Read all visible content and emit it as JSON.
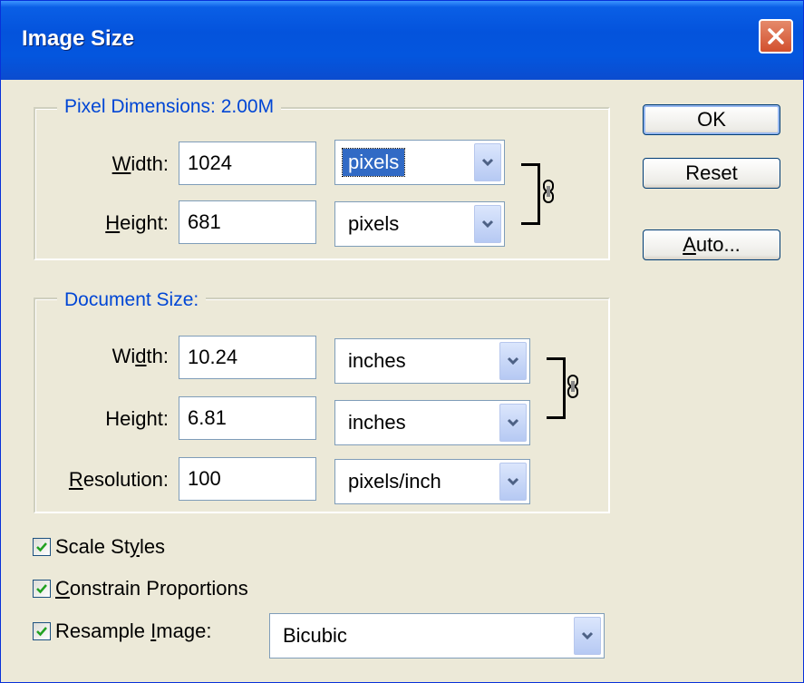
{
  "window": {
    "title": "Image Size",
    "close_icon": "close-icon"
  },
  "pixel_dimensions": {
    "legend": "Pixel Dimensions:  2.00M",
    "width": {
      "label_pre": "",
      "label_key": "W",
      "label_post": "idth:",
      "value": "1024",
      "unit": "pixels"
    },
    "height": {
      "label_pre": "",
      "label_key": "H",
      "label_post": "eight:",
      "value": "681",
      "unit": "pixels"
    }
  },
  "document_size": {
    "legend": "Document Size:",
    "width": {
      "label_pre": "Wi",
      "label_key": "d",
      "label_post": "th:",
      "value": "10.24",
      "unit": "inches"
    },
    "height": {
      "label_pre": "Hei",
      "label_key": "g",
      "label_post": "ht:",
      "value": "6.81",
      "unit": "inches"
    },
    "resolution": {
      "label_pre": "",
      "label_key": "R",
      "label_post": "esolution:",
      "value": "100",
      "unit": "pixels/inch"
    }
  },
  "buttons": {
    "ok": "OK",
    "reset": "Reset",
    "auto_key": "A",
    "auto_rest": "uto..."
  },
  "options": {
    "scale_styles": {
      "pre": "Scale St",
      "key": "y",
      "post": "les",
      "checked": true
    },
    "constrain": {
      "pre": "",
      "key": "C",
      "post": "onstrain Proportions",
      "checked": true
    },
    "resample": {
      "pre": "Resample ",
      "key": "I",
      "post": "mage:",
      "checked": true,
      "method": "Bicubic"
    }
  },
  "colors": {
    "title_bar": "#0453dc",
    "legend_text": "#0046d5",
    "dialog_bg": "#ece9d8",
    "selection": "#316ac5"
  }
}
